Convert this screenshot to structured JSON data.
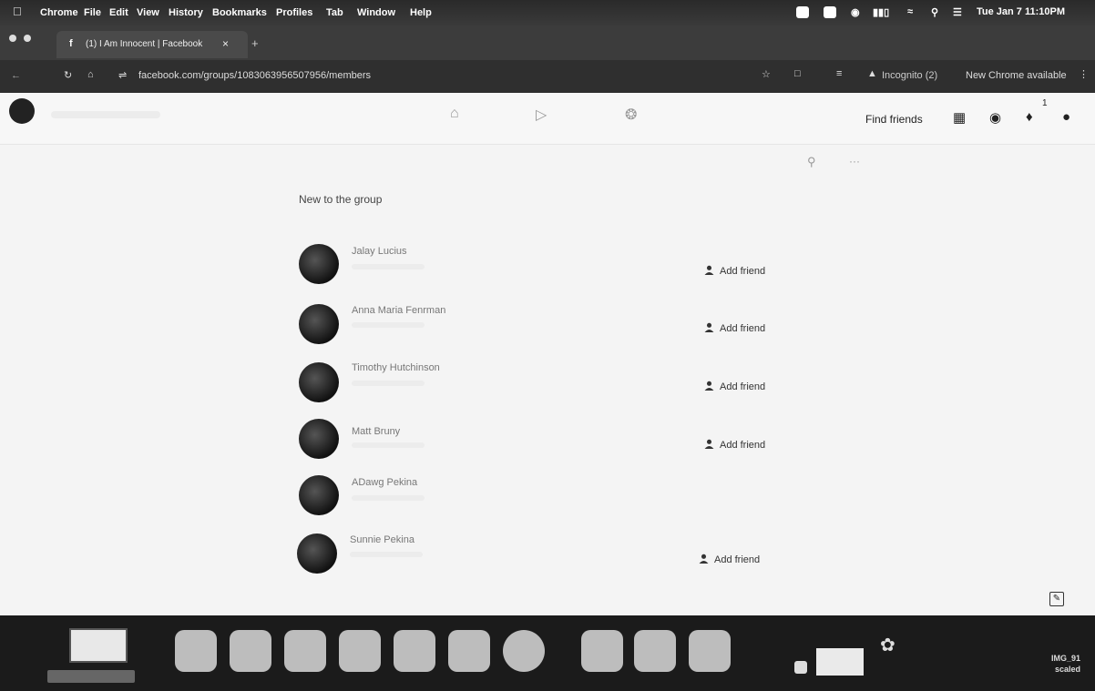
{
  "menubar": {
    "app": "Chrome",
    "items": [
      "File",
      "Edit",
      "View",
      "History",
      "Bookmarks",
      "Profiles",
      "Tab",
      "Window",
      "Help"
    ],
    "clock": "Tue Jan 7  11:10PM"
  },
  "browser": {
    "tab_title": "(1) I Am Innocent | Facebook",
    "tab_close": "×",
    "new_tab": "+",
    "url": "facebook.com/groups/1083063956507956/members",
    "incognito_label": "Incognito (2)",
    "update_label": "New Chrome available"
  },
  "fb": {
    "find_friends": "Find friends",
    "notif_count": "1",
    "more_label": "···"
  },
  "section": {
    "title": "New to the group"
  },
  "members": [
    {
      "name": "Jalay Lucius",
      "add": "Add friend"
    },
    {
      "name": "Anna Maria Fenrman",
      "add": "Add friend"
    },
    {
      "name": "Timothy Hutchinson",
      "add": "Add friend"
    },
    {
      "name": "Matt Bruny",
      "add": "Add friend"
    },
    {
      "name": "ADawg Pekina",
      "add": ""
    },
    {
      "name": "Sunnie Pekina",
      "add": "Add friend"
    }
  ],
  "dock": {
    "file_caption": "IMG_91",
    "file_caption2": "scaled"
  },
  "colors": {
    "menubar": "#2e2e2e",
    "page_bg": "#f4f4f4",
    "dock": "#1b1b1b"
  }
}
